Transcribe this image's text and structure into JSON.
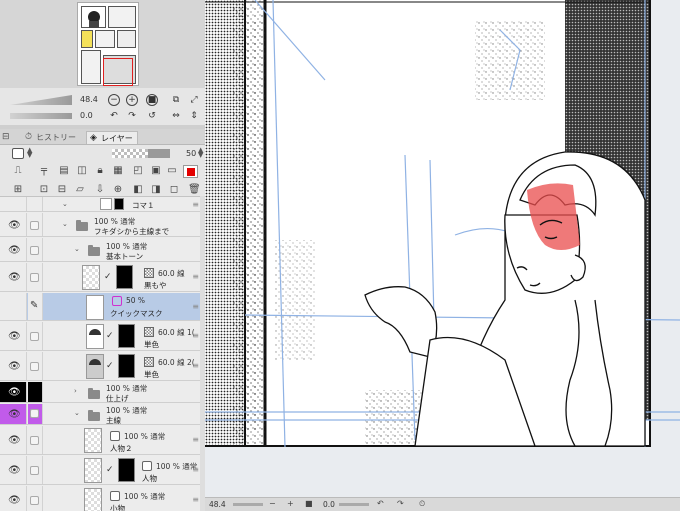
{
  "navigator": {
    "zoom_value": "48.4",
    "rotation_value": "0.0"
  },
  "tabs": {
    "history": "ヒストリー",
    "layer": "レイヤー"
  },
  "layer_panel": {
    "opacity": "50",
    "draw_color": "#e30000"
  },
  "layers": [
    {
      "pct": "",
      "name": "コマ１"
    },
    {
      "pct": "100 % 通常",
      "name": "フキダシから主線まで"
    },
    {
      "pct": "100 % 通常",
      "name": "基本トーン"
    },
    {
      "pct": "60.0 線",
      "name": "黒もや"
    },
    {
      "pct": "50 %",
      "name": "クイックマスク"
    },
    {
      "pct": "60.0 線 1(",
      "name": "単色"
    },
    {
      "pct": "60.0 線 2(",
      "name": "単色"
    },
    {
      "pct": "100 % 通常",
      "name": "仕上げ"
    },
    {
      "pct": "100 % 通常",
      "name": "主線"
    },
    {
      "pct": "100 % 通常",
      "name": "人物２"
    },
    {
      "pct": "100 % 通常",
      "name": "人物"
    },
    {
      "pct": "100 % 通常",
      "name": "小物"
    }
  ],
  "status_bar": {
    "zoom": "48.4",
    "rotation": "0.0"
  },
  "icons": {
    "nav_zoom_out": "minus-circle-icon",
    "nav_zoom_in": "plus-circle-icon",
    "eye": "eye-icon",
    "lock": "lock-icon",
    "folder": "folder-icon",
    "trash": "trash-icon"
  }
}
